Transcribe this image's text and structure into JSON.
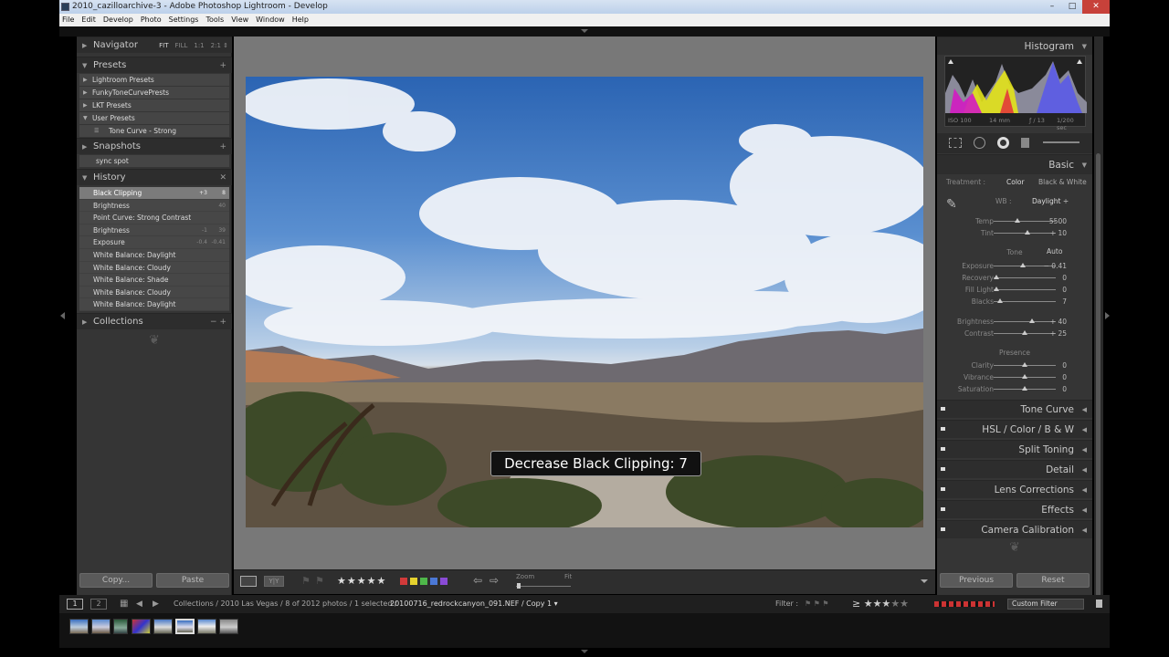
{
  "window": {
    "title": "2010_cazilloarchive-3 - Adobe Photoshop Lightroom - Develop",
    "controls": [
      "–",
      "□",
      "✕"
    ]
  },
  "menu": [
    "File",
    "Edit",
    "Develop",
    "Photo",
    "Settings",
    "Tools",
    "View",
    "Window",
    "Help"
  ],
  "navigator": {
    "title": "Navigator",
    "options": [
      "FIT",
      "FILL",
      "1:1",
      "2:1 ⇕"
    ]
  },
  "presets": {
    "title": "Presets",
    "items": [
      "Lightroom Presets",
      "FunkyToneCurvePrests",
      "LKT Presets",
      "User Presets",
      "Tone Curve - Strong"
    ]
  },
  "snapshots": {
    "title": "Snapshots",
    "items": [
      "sync spot"
    ]
  },
  "history": {
    "title": "History",
    "items": [
      {
        "label": "Black Clipping",
        "v1": "+3",
        "v2": "8"
      },
      {
        "label": "Brightness",
        "v1": "",
        "v2": "40"
      },
      {
        "label": "Point Curve: Strong Contrast",
        "v1": "",
        "v2": ""
      },
      {
        "label": "Brightness",
        "v1": "-1",
        "v2": "39"
      },
      {
        "label": "Exposure",
        "v1": "-0.4",
        "v2": "-0.41"
      },
      {
        "label": "White Balance: Daylight",
        "v1": "",
        "v2": ""
      },
      {
        "label": "White Balance: Cloudy",
        "v1": "",
        "v2": ""
      },
      {
        "label": "White Balance: Shade",
        "v1": "",
        "v2": ""
      },
      {
        "label": "White Balance: Cloudy",
        "v1": "",
        "v2": ""
      },
      {
        "label": "White Balance: Daylight",
        "v1": "",
        "v2": ""
      }
    ]
  },
  "collections": {
    "title": "Collections"
  },
  "left_buttons": {
    "copy": "Copy...",
    "paste": "Paste"
  },
  "toast": "Decrease Black Clipping: 7",
  "toolbar": {
    "zoom_label": "Zoom",
    "fit_label": "Fit",
    "label_colors": [
      "#d23a3a",
      "#e6d22e",
      "#4fb84a",
      "#4b78d6",
      "#8a4bd6"
    ]
  },
  "histogram": {
    "title": "Histogram",
    "iso": "ISO 100",
    "focal": "14 mm",
    "aperture": "ƒ / 13",
    "shutter": "1/200 sec"
  },
  "basic": {
    "title": "Basic",
    "treatment_label": "Treatment :",
    "color": "Color",
    "bw": "Black & White",
    "wb_label": "WB :",
    "wb_value": "Daylight ÷",
    "tone_label": "Tone",
    "auto": "Auto",
    "presence_label": "Presence",
    "wb_sliders": [
      {
        "label": "Temp",
        "value": "5500",
        "pos": 0.38
      },
      {
        "label": "Tint",
        "value": "+ 10",
        "pos": 0.55
      }
    ],
    "tone_sliders": [
      {
        "label": "Exposure",
        "value": "− 0.41",
        "pos": 0.47
      },
      {
        "label": "Recovery",
        "value": "0",
        "pos": 0.05
      },
      {
        "label": "Fill Light",
        "value": "0",
        "pos": 0.05
      },
      {
        "label": "Blacks",
        "value": "7",
        "pos": 0.1
      }
    ],
    "bright_sliders": [
      {
        "label": "Brightness",
        "value": "+ 40",
        "pos": 0.62
      },
      {
        "label": "Contrast",
        "value": "+ 25",
        "pos": 0.5
      }
    ],
    "presence_sliders": [
      {
        "label": "Clarity",
        "value": "0",
        "pos": 0.5
      },
      {
        "label": "Vibrance",
        "value": "0",
        "pos": 0.5
      },
      {
        "label": "Saturation",
        "value": "0",
        "pos": 0.5
      }
    ]
  },
  "panels": [
    "Tone Curve",
    "HSL / Color / B & W",
    "Split Toning",
    "Detail",
    "Lens Corrections",
    "Effects",
    "Camera Calibration"
  ],
  "right_buttons": {
    "previous": "Previous",
    "reset": "Reset"
  },
  "filmbar": {
    "page1": "1",
    "page2": "2",
    "path": "Collections / 2010 Las Vegas / 8 of 2012 photos / 1 selected /",
    "filename": "20100716_redrockcanyon_091.NEF / Copy 1 ▾",
    "filter_label": "Filter :",
    "filter_value": "Custom Filter"
  }
}
